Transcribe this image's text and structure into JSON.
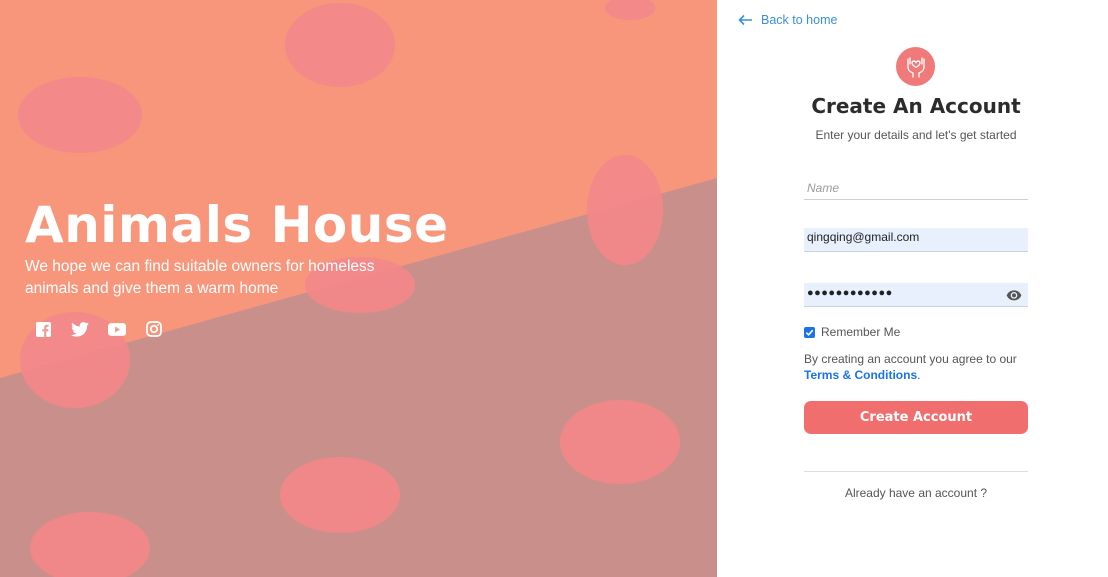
{
  "hero": {
    "title": "Animals House",
    "subtitle": "We hope we can find suitable owners for homeless animals and give them a warm home",
    "socials": [
      {
        "icon": "facebook-icon"
      },
      {
        "icon": "twitter-icon"
      },
      {
        "icon": "youtube-icon"
      },
      {
        "icon": "instagram-icon"
      }
    ],
    "colors": {
      "upper": "#f7967a",
      "lower": "#c9908b",
      "cookie": "#f2888a"
    }
  },
  "nav": {
    "back_label": "Back to home"
  },
  "form": {
    "logo_icon": "hands-heart-icon",
    "title": "Create An Account",
    "subtitle": "Enter your details and let's get started",
    "name_placeholder": "Name",
    "email_value": "qingqing@gmail.com",
    "password_value": "●●●●●●●●●●●●",
    "remember_label": "Remember Me",
    "remember_checked": true,
    "terms_text": "By creating an account you agree to our",
    "terms_link": "Terms & Conditions",
    "terms_period": ".",
    "submit_label": "Create Account",
    "already_label": "Already have an account ?",
    "colors": {
      "accent": "#f06e6e",
      "link": "#1a73e8",
      "autofill": "#e8f0fe"
    }
  }
}
